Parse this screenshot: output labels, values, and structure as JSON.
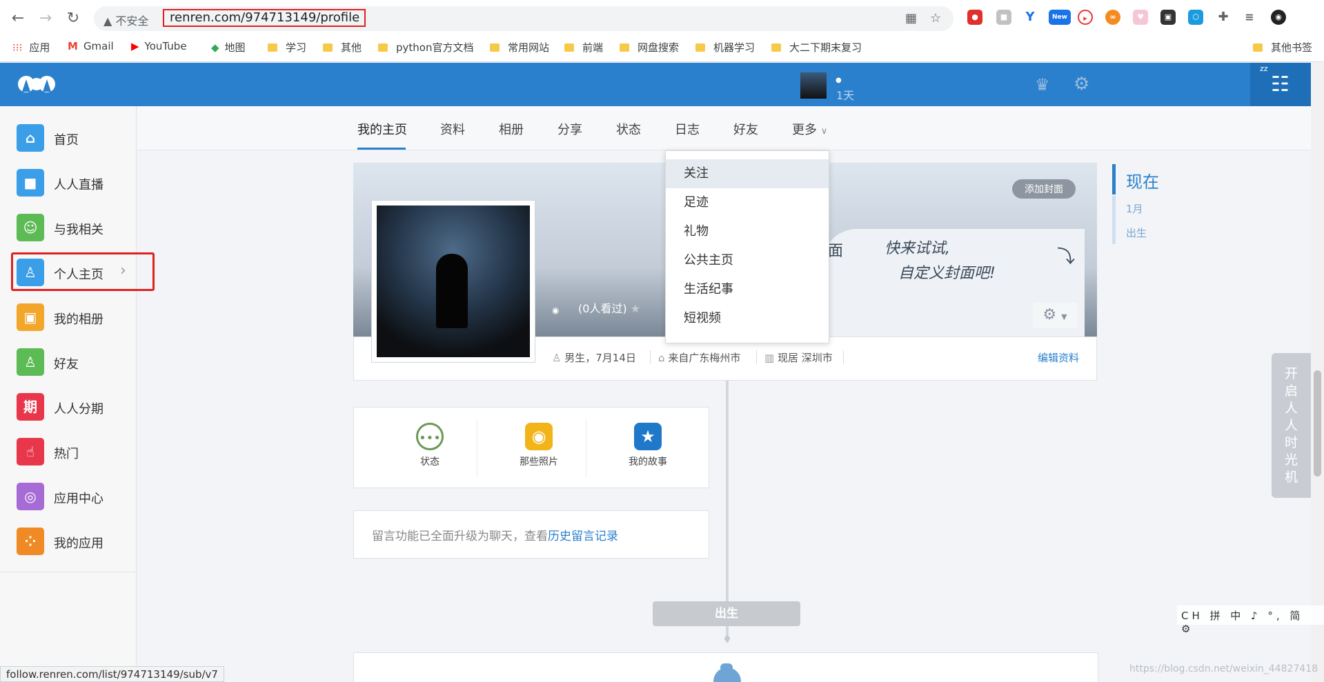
{
  "browser": {
    "insecure_label": "不安全",
    "url": "renren.com/974713149/profile",
    "status_url": "follow.renren.com/list/974713149/sub/v7",
    "new_badge": "New",
    "bookmarks": [
      "应用",
      "Gmail",
      "YouTube",
      "地图",
      "学习",
      "其他",
      "python官方文档",
      "常用网站",
      "前端",
      "网盘搜索",
      "机器学习",
      "大二下期末复习"
    ],
    "other_bookmarks": "其他书签"
  },
  "header": {
    "days": "1天"
  },
  "sidebar": {
    "items": [
      {
        "label": "首页",
        "color": "#3a9ee8",
        "glyph": "⌂"
      },
      {
        "label": "人人直播",
        "color": "#3a9ee8",
        "glyph": "■"
      },
      {
        "label": "与我相关",
        "color": "#5dbb55",
        "glyph": "☺"
      },
      {
        "label": "个人主页",
        "color": "#3a9ee8",
        "glyph": "♙"
      },
      {
        "label": "我的相册",
        "color": "#f2a72b",
        "glyph": "▣"
      },
      {
        "label": "好友",
        "color": "#5dbb55",
        "glyph": "♙"
      },
      {
        "label": "人人分期",
        "color": "#e8374a",
        "glyph": "期"
      },
      {
        "label": "热门",
        "color": "#e8374a",
        "glyph": "☝"
      },
      {
        "label": "应用中心",
        "color": "#a76bd6",
        "glyph": "◎"
      },
      {
        "label": "我的应用",
        "color": "#f08a24",
        "glyph": "⁘"
      }
    ],
    "chevron": "›"
  },
  "tabs": [
    "我的主页",
    "资料",
    "相册",
    "分享",
    "状态",
    "日志",
    "好友",
    "更多"
  ],
  "dropdown": [
    "关注",
    "足迹",
    "礼物",
    "公共主页",
    "生活纪事",
    "短视频"
  ],
  "cover": {
    "add_cover": "添加封面",
    "promo_line1": "快来试试,",
    "promo_line2": "自定义封面吧!",
    "promo_face": "面"
  },
  "profile": {
    "visits": "(0人看过)",
    "gender_birthday": "男生，7月14日",
    "hometown": "来自广东梅州市",
    "residence": "现居 深圳市",
    "edit": "编辑资料"
  },
  "actions": [
    "状态",
    "那些照片",
    "我的故事"
  ],
  "notice": {
    "text": "留言功能已全面升级为聊天，查看",
    "link": "历史留言记录"
  },
  "timeline": {
    "birth": "出生"
  },
  "right_nav": {
    "now": "现在",
    "jan": "1月",
    "birth": "出生"
  },
  "time_machine": "开启人人时光机",
  "ime": "CH 拼 中 ♪ °, 简 ⚙",
  "watermark": "https://blog.csdn.net/weixin_44827418"
}
